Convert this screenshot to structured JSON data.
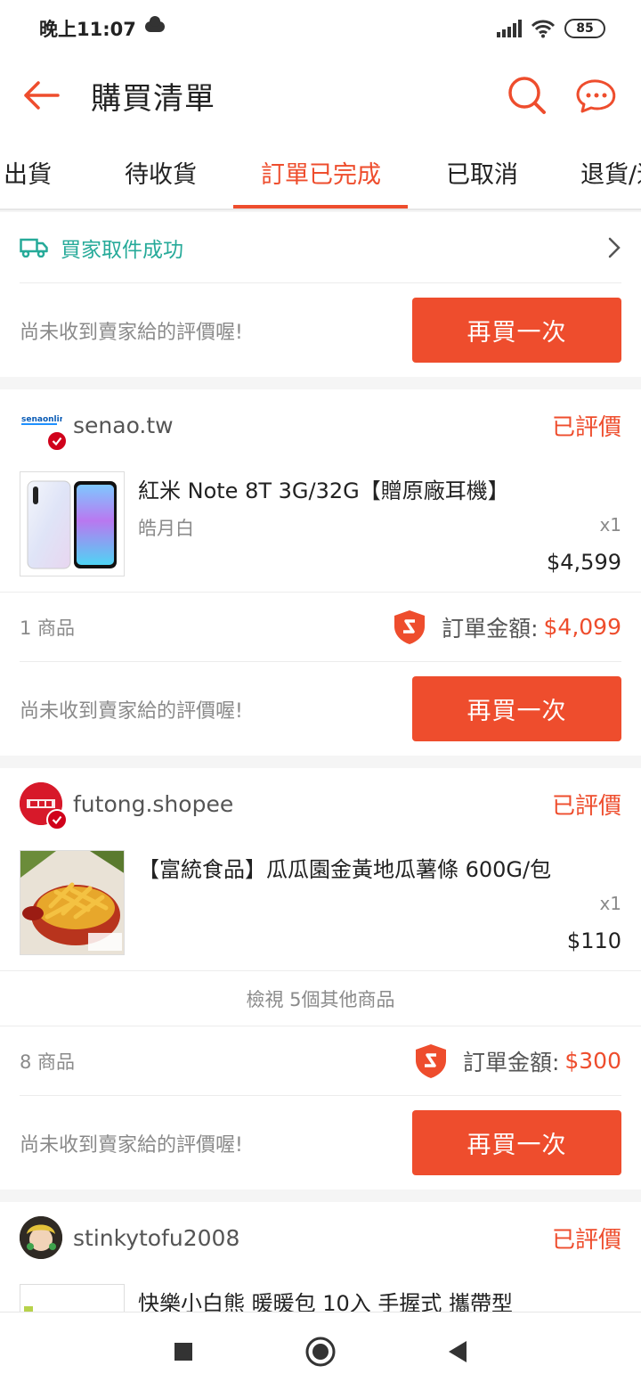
{
  "status_bar": {
    "time": "晚上11:07",
    "battery": "85"
  },
  "header": {
    "title": "購買清單"
  },
  "tabs": [
    {
      "label": "出貨",
      "active": false
    },
    {
      "label": "待收貨",
      "active": false
    },
    {
      "label": "訂單已完成",
      "active": true
    },
    {
      "label": "已取消",
      "active": false
    },
    {
      "label": "退貨/退款",
      "active": false
    }
  ],
  "colors": {
    "accent": "#ee4d2d",
    "shipping_green": "#26aa99"
  },
  "first_card": {
    "shipping_status": "買家取件成功",
    "hint": "尚未收到賣家給的評價喔!",
    "button": "再買一次"
  },
  "orders": [
    {
      "shop": "senao.tw",
      "status": "已評價",
      "items": [
        {
          "name": "紅米 Note 8T 3G/32G【贈原廠耳機】",
          "variant": "皓月白",
          "qty": "x1",
          "price": "$4,599"
        }
      ],
      "count": "1 商品",
      "total_label": "訂單金額:",
      "total": "$4,099",
      "hint": "尚未收到賣家給的評價喔!",
      "button": "再買一次"
    },
    {
      "shop": "futong.shopee",
      "status": "已評價",
      "items": [
        {
          "name": "【富統食品】瓜瓜園金黃地瓜薯條 600G/包",
          "variant": "",
          "qty": "x1",
          "price": "$110"
        }
      ],
      "view_more": "檢視 5個其他商品",
      "count": "8 商品",
      "total_label": "訂單金額:",
      "total": "$300",
      "hint": "尚未收到賣家給的評價喔!",
      "button": "再買一次"
    },
    {
      "shop": "stinkytofu2008",
      "status": "已評價",
      "items": [
        {
          "name": "快樂小白熊 暖暖包 10入 手握式 攜帶型",
          "variant": "",
          "qty": "",
          "price": ""
        }
      ]
    }
  ]
}
